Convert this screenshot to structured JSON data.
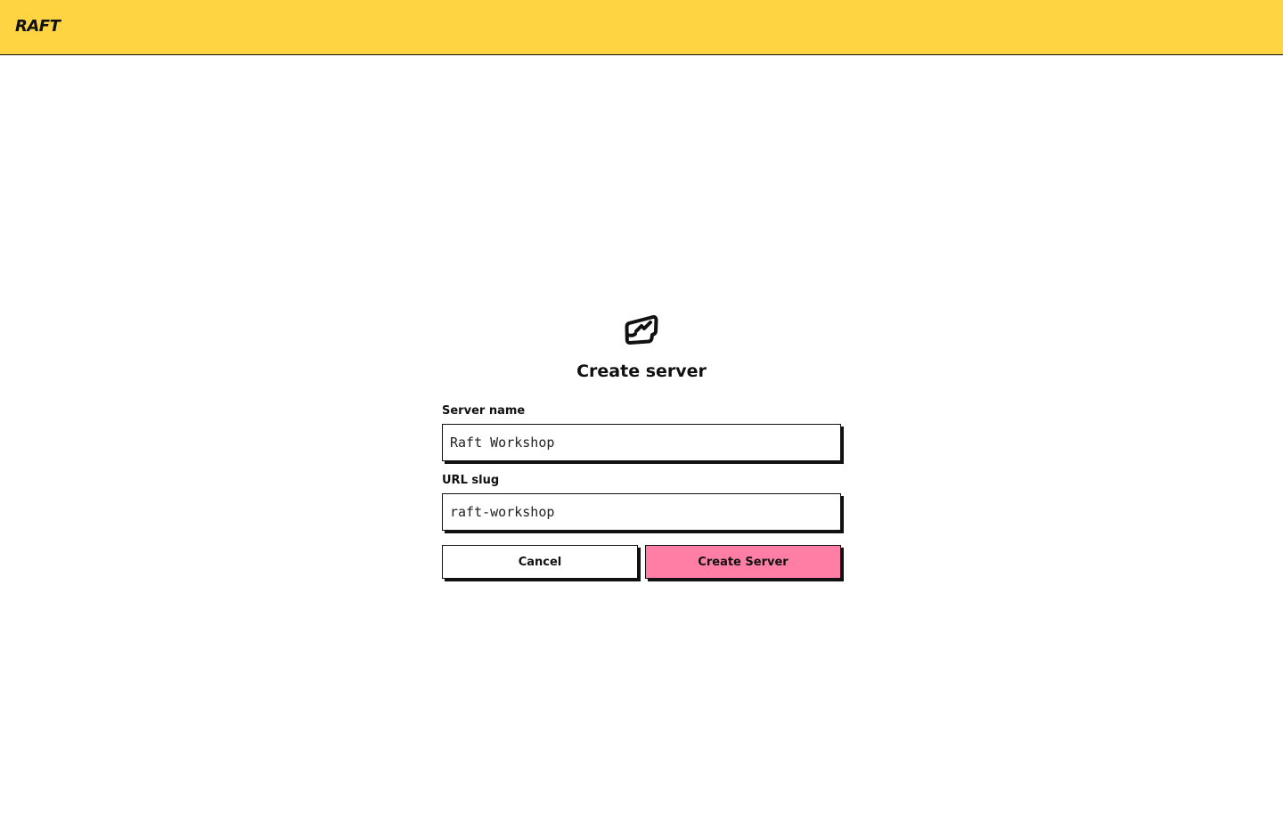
{
  "header": {
    "brand": "RAFT",
    "background_color": "#ffd443"
  },
  "form": {
    "logo_icon": "server-badge-icon",
    "title": "Create server",
    "server_name": {
      "label": "Server name",
      "value": "Raft Workshop"
    },
    "url_slug": {
      "label": "URL slug",
      "value": "raft-workshop"
    },
    "buttons": {
      "cancel": "Cancel",
      "create": "Create Server",
      "create_color": "#ff7ea6"
    }
  }
}
